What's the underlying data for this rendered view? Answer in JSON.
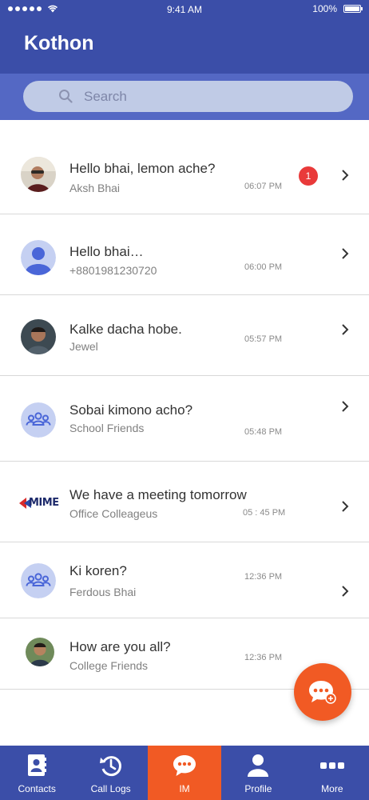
{
  "status_bar": {
    "time": "9:41 AM",
    "battery": "100%"
  },
  "app": {
    "title": "Kothon"
  },
  "search": {
    "placeholder": "Search"
  },
  "conversations": [
    {
      "message": "Hello bhai, lemon ache?",
      "name": "Aksh Bhai",
      "time": "06:07 PM",
      "unread": "1",
      "avatar": "photo-avatar"
    },
    {
      "message": "Hello bhai…",
      "name": "+8801981230720",
      "time": "06:00 PM",
      "avatar": "person-placeholder"
    },
    {
      "message": "Kalke dacha hobe.",
      "name": "Jewel",
      "time": "05:57 PM",
      "avatar": "photo-avatar"
    },
    {
      "message": "Sobai kimono acho?",
      "name": "School Friends",
      "time": "05:48 PM",
      "avatar": "group-icon"
    },
    {
      "message": "We have a meeting tomorrow",
      "name": "Office Colleageus",
      "time": "05 : 45 PM",
      "avatar": "mime-logo",
      "logo_text": "MIME"
    },
    {
      "message": "Ki koren?",
      "name": "Ferdous Bhai",
      "time": "12:36 PM",
      "avatar": "group-icon"
    },
    {
      "message": "How are you all?",
      "name": "College Friends",
      "time": "12:36 PM",
      "avatar": "photo-avatar"
    }
  ],
  "tabs": [
    {
      "label": "Contacts",
      "icon": "contacts-icon"
    },
    {
      "label": "Call Logs",
      "icon": "call-logs-icon"
    },
    {
      "label": "IM",
      "icon": "chat-icon"
    },
    {
      "label": "Profile",
      "icon": "profile-icon"
    },
    {
      "label": "More",
      "icon": "more-icon"
    }
  ],
  "colors": {
    "primary": "#3b4ea8",
    "search_band": "#5468c4",
    "accent": "#f15a24",
    "badge": "#e93a3a"
  }
}
